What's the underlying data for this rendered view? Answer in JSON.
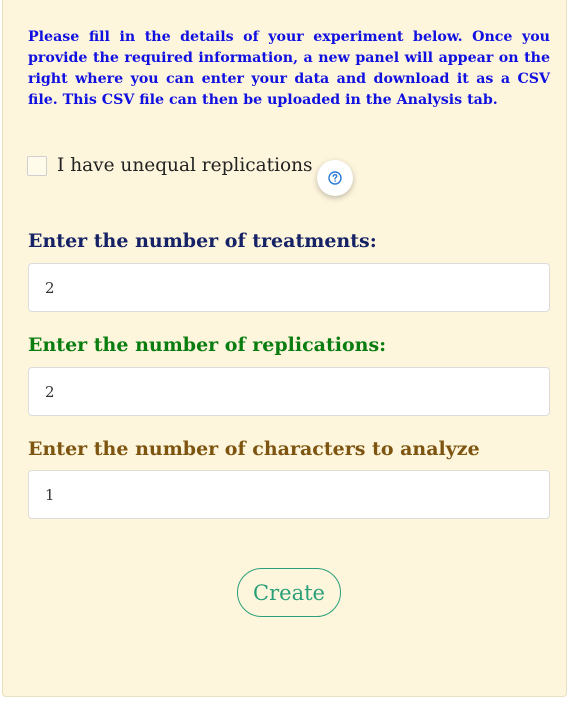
{
  "intro_text": "Please fill in the details of your experiment below. Once you provide the required information, a new panel will appear on the right where you can enter your data and download it as a CSV file. This CSV file can then be uploaded in the Analysis tab.",
  "unequal_replications": {
    "label": "I have unequal replications",
    "checked": false,
    "help_icon": "question-circle-icon"
  },
  "treatments": {
    "label": "Enter the number of treatments:",
    "value": "2"
  },
  "replications": {
    "label": "Enter the number of replications:",
    "value": "2"
  },
  "characters": {
    "label": "Enter the number of characters to analyze",
    "value": "1"
  },
  "create_button": {
    "label": "Create"
  },
  "colors": {
    "intro": "#1010e0",
    "treatments_label": "#152266",
    "replications_label": "#0a7d10",
    "characters_label": "#7d5510",
    "create_button": "#2aa07a",
    "panel_background": "#fdf5dc"
  }
}
